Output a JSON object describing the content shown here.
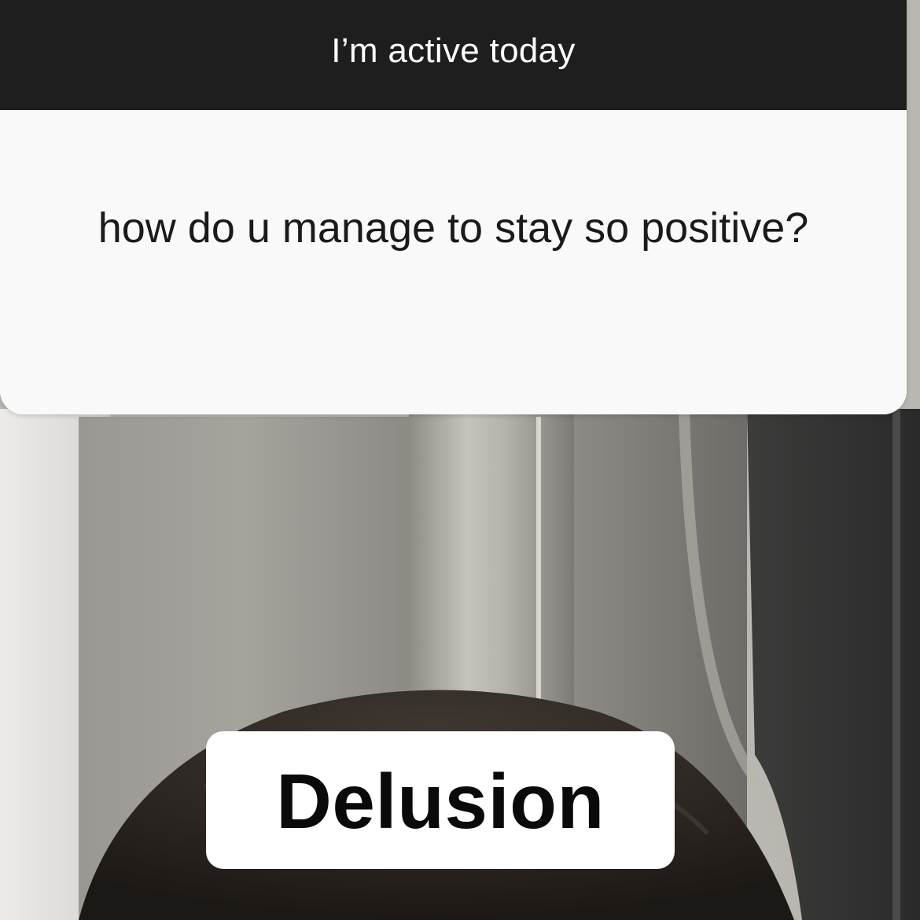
{
  "story": {
    "question_header": "I’m active today",
    "question": "how do u manage to stay so positive?",
    "answer": "Delusion"
  },
  "colors": {
    "header_bg": "#1e1e1e",
    "card_bg": "#f9f9f9",
    "answer_bg": "#ffffff",
    "text_dark": "#1a1a1a"
  }
}
